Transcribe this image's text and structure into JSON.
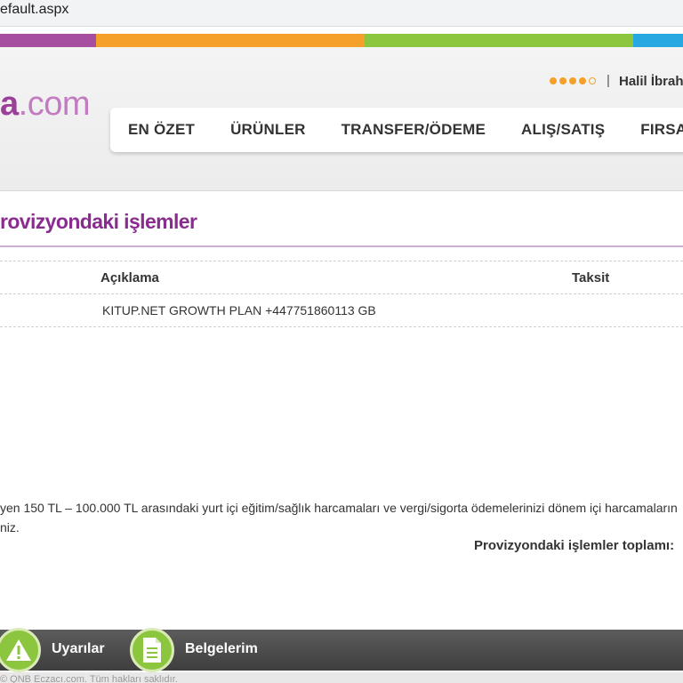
{
  "browser": {
    "url": "efault.aspx"
  },
  "brand": {
    "logo_letter": "a",
    "logo_suffix": ".com"
  },
  "user_bar": {
    "separator": "|",
    "user_name": "Halil İbrah"
  },
  "nav": {
    "items": [
      "EN ÖZET",
      "ÜRÜNLER",
      "TRANSFER/ÖDEME",
      "ALIŞ/SATIŞ",
      "FIRSATLA"
    ]
  },
  "page": {
    "title": "rovizyondaki işlemler"
  },
  "table": {
    "headers": {
      "description": "Açıklama",
      "installment": "Taksit"
    },
    "rows": [
      {
        "description": "KITUP.NET GROWTH PLAN +447751860113 GB",
        "installment": ""
      }
    ]
  },
  "notes": {
    "line1": "yen 150 TL – 100.000 TL arasındaki yurt içi eğitim/sağlık harcamaları ve vergi/sigorta ödemelerinizi dönem içi harcamaların",
    "line2": "niz.",
    "total_label": "Provizyondaki işlemler toplamı:"
  },
  "footer": {
    "warnings_label": "Uyarılar",
    "documents_label": "Belgelerim",
    "copyright": "© QNB Eczacı.com. Tüm hakları saklıdır."
  },
  "colors": {
    "brand_purple": "#9b3f98",
    "accent_orange": "#f5a02a",
    "accent_green": "#8cc63f",
    "accent_blue": "#27a8e0"
  }
}
